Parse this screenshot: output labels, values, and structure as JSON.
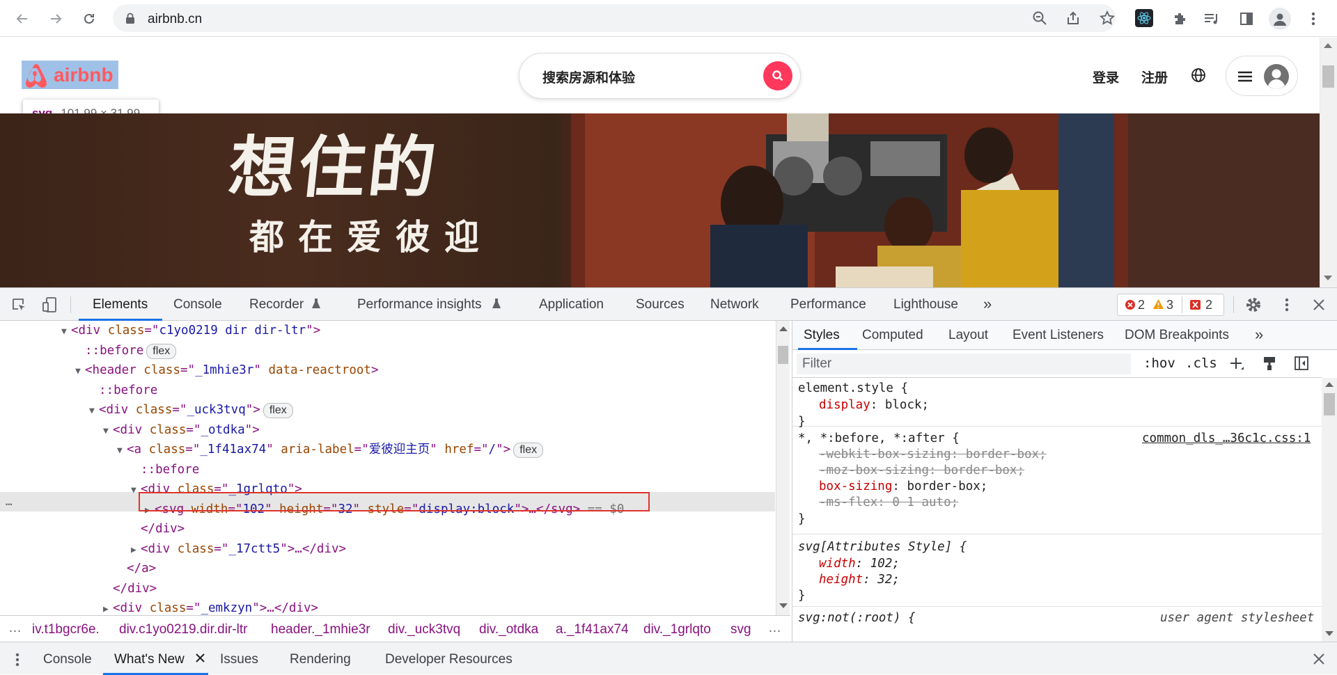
{
  "browser": {
    "url": "airbnb.cn",
    "nav": [
      "back-icon",
      "forward-icon",
      "reload-icon"
    ],
    "toolbar_icons": [
      "zoom-icon",
      "share-icon",
      "star-icon",
      "react-devtools-icon",
      "extensions-icon",
      "media-icon",
      "sidepanel-icon",
      "profile-icon",
      "kebab-icon"
    ]
  },
  "page": {
    "brand": "airbnb",
    "tooltip": {
      "tag": "svg",
      "size": "101.99 × 31.99"
    },
    "search_placeholder": "搜索房源和体验",
    "login": "登录",
    "signup": "注册",
    "hero_line1": "想住的",
    "hero_line2": "都在爱彼迎",
    "accent_color": "#ff385c"
  },
  "devtools": {
    "tabs": [
      "Elements",
      "Console",
      "Recorder",
      "Performance insights",
      "Application",
      "Sources",
      "Network",
      "Performance",
      "Lighthouse"
    ],
    "active_tab": "Elements",
    "errors": "2",
    "warnings": "3",
    "issues": "2",
    "dom": [
      {
        "pre": "<",
        "tag": "div",
        "attrs": [
          [
            "class",
            "c1yo0219 dir dir-ltr"
          ]
        ],
        "post": ">"
      },
      {
        "pseudo": "::before",
        "badge": "flex"
      },
      {
        "pre": "<",
        "tag": "header",
        "attrs": [
          [
            "class",
            "_1mhie3r"
          ],
          [
            "data-reactroot",
            ""
          ]
        ],
        "post": ">"
      },
      {
        "pseudo": "::before"
      },
      {
        "pre": "<",
        "tag": "div",
        "attrs": [
          [
            "class",
            "_uck3tvq"
          ]
        ],
        "post": ">",
        "badge": "flex"
      },
      {
        "pre": "<",
        "tag": "div",
        "attrs": [
          [
            "class",
            "_otdka"
          ]
        ],
        "post": ">"
      },
      {
        "pre": "<",
        "tag": "a",
        "attrs": [
          [
            "class",
            "_1f41ax74"
          ],
          [
            "aria-label",
            "爱彼迎主页"
          ],
          [
            "href",
            "/"
          ]
        ],
        "post": ">",
        "badge": "flex"
      },
      {
        "pseudo": "::before"
      },
      {
        "pre": "<",
        "tag": "div",
        "attrs": [
          [
            "class",
            "_1grlqto"
          ]
        ],
        "post": ">"
      },
      {
        "pre": "<",
        "tag": "svg",
        "attrs": [
          [
            "width",
            "102"
          ],
          [
            "height",
            "32"
          ],
          [
            "style",
            "display:block"
          ]
        ],
        "post": ">…</svg>",
        "suffix": " == $0"
      },
      {
        "close": "</div>"
      },
      {
        "pre": "<",
        "tag": "div",
        "attrs": [
          [
            "class",
            "_17ctt5"
          ]
        ],
        "post": ">…</div>"
      },
      {
        "close": "</a>"
      },
      {
        "close": "</div>"
      },
      {
        "pre": "<",
        "tag": "div",
        "attrs": [
          [
            "class",
            "_emkzyn"
          ]
        ],
        "post": ">…</div>"
      }
    ],
    "breadcrumbs": [
      "iv.t1bgcr6e.",
      "div.c1yo0219.dir.dir-ltr",
      "header._1mhie3r",
      "div._uck3tvq",
      "div._otdka",
      "a._1f41ax74",
      "div._1grlqto",
      "svg"
    ],
    "styles_tabs": [
      "Styles",
      "Computed",
      "Layout",
      "Event Listeners",
      "DOM Breakpoints"
    ],
    "filter_placeholder": "Filter",
    "hov": ":hov",
    "cls": ".cls",
    "rules": {
      "r1_sel": "element.style {",
      "r1_p1": "display",
      "r1_v1": "block;",
      "r2_sel": "*, *:before, *:after {",
      "r2_src": "common_dls_…36c1c.css:1",
      "r2_l1": "-webkit-box-sizing: border-box;",
      "r2_l2": "-moz-box-sizing: border-box;",
      "r2_p3": "box-sizing",
      "r2_v3": "border-box;",
      "r2_l4": "-ms-flex: 0 1 auto;",
      "r3_sel": "svg[Attributes Style] {",
      "r3_p1": "width",
      "r3_v1": "102;",
      "r3_p2": "height",
      "r3_v2": "32;",
      "r4_sel": "svg:not(:root) {",
      "r4_src": "user agent stylesheet",
      "close": "}"
    },
    "drawer_tabs": [
      "Console",
      "What's New",
      "Issues",
      "Rendering",
      "Developer Resources"
    ]
  }
}
